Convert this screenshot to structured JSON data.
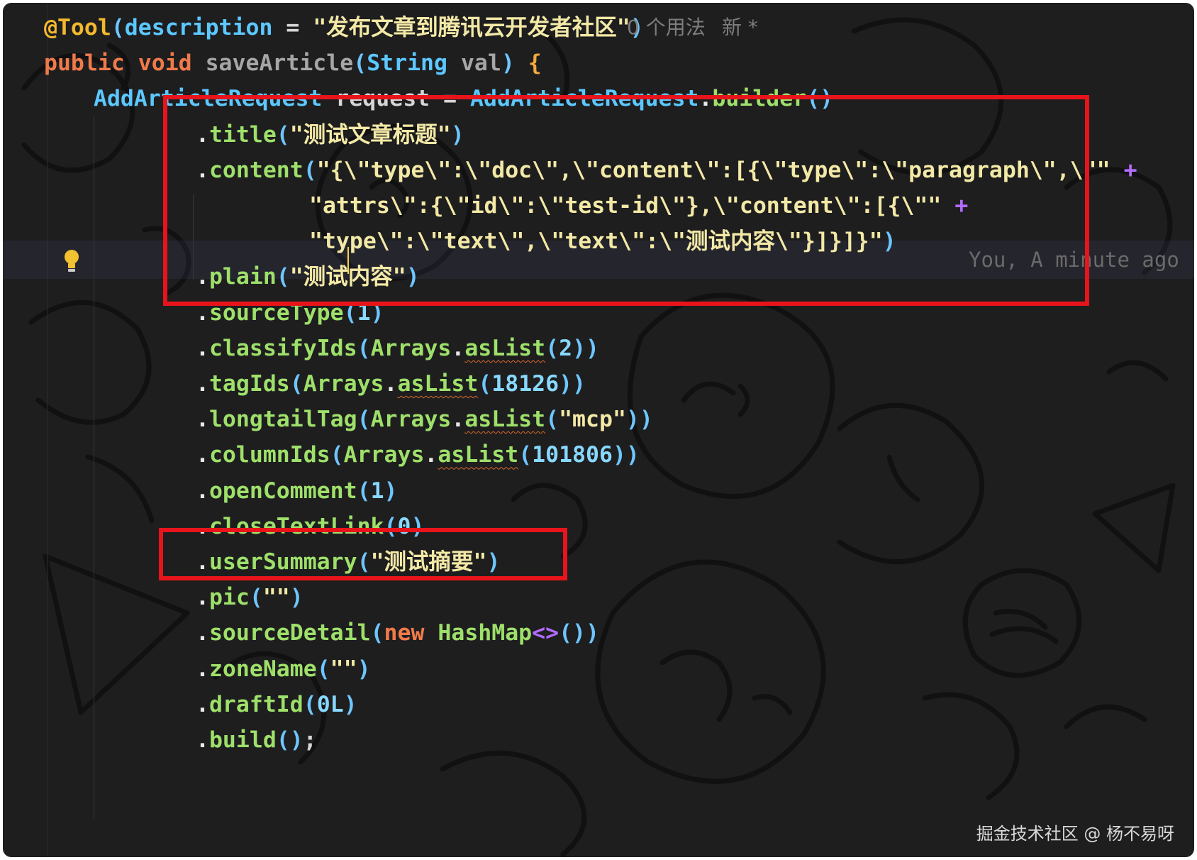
{
  "editor": {
    "annotation_hint": {
      "usages": "0 个用法",
      "status": "新 *"
    },
    "blame": "You, A minute ago",
    "lines": [
      [
        [
          "@Tool",
          "anno"
        ],
        [
          "(",
          "paren"
        ],
        [
          "description",
          "type"
        ],
        [
          " = ",
          "default"
        ],
        [
          "\"发布文章到腾讯云开发者社区\"",
          "str"
        ],
        [
          ")",
          "paren"
        ]
      ],
      [
        [
          "public",
          "kw"
        ],
        [
          " ",
          "default"
        ],
        [
          "void",
          "kw"
        ],
        [
          " ",
          "default"
        ],
        [
          "saveArticle",
          "gray"
        ],
        [
          "(",
          "paren"
        ],
        [
          "String",
          "type"
        ],
        [
          " ",
          "default"
        ],
        [
          "val",
          "gray"
        ],
        [
          ")",
          "paren"
        ],
        [
          " ",
          "default"
        ],
        [
          "{",
          "brace"
        ]
      ],
      [
        [
          "AddArticleRequest",
          "type"
        ],
        [
          " ",
          "default"
        ],
        [
          "request",
          "default"
        ],
        [
          " = ",
          "default"
        ],
        [
          "AddArticleRequest",
          "type"
        ],
        [
          ".",
          "dot"
        ],
        [
          "builder",
          "method"
        ],
        [
          "()",
          "paren"
        ]
      ],
      [
        [
          ".",
          "dot"
        ],
        [
          "title",
          "method"
        ],
        [
          "(",
          "paren"
        ],
        [
          "\"测试文章标题\"",
          "str"
        ],
        [
          ")",
          "paren"
        ]
      ],
      [
        [
          ".",
          "dot"
        ],
        [
          "content",
          "method"
        ],
        [
          "(",
          "paren"
        ],
        [
          "\"{\\\"type\\\":\\\"doc\\\",\\\"content\\\":[{\\\"type\\\":\\\"paragraph\\\",\\\"\"",
          "str"
        ],
        [
          " ",
          "default"
        ],
        [
          "+",
          "plus"
        ]
      ],
      [
        [
          "\"attrs\\\":{\\\"id\\\":\\\"test-id\\\"},\\\"content\\\":[{\\\"\"",
          "str"
        ],
        [
          " ",
          "default"
        ],
        [
          "+",
          "plus"
        ]
      ],
      [
        [
          "\"type\\\":\\\"text\\\",\\\"text\\\":\\\"测试内容\\\"}]}]}\"",
          "str"
        ],
        [
          ")",
          "paren"
        ]
      ],
      [
        [
          ".",
          "dot"
        ],
        [
          "plain",
          "method"
        ],
        [
          "(",
          "paren"
        ],
        [
          "\"测试内容\"",
          "str"
        ],
        [
          ")",
          "paren"
        ]
      ],
      [
        [
          ".",
          "dot"
        ],
        [
          "sourceType",
          "method"
        ],
        [
          "(",
          "paren"
        ],
        [
          "1",
          "num"
        ],
        [
          ")",
          "paren"
        ]
      ],
      [
        [
          ".",
          "dot"
        ],
        [
          "classifyIds",
          "method"
        ],
        [
          "(",
          "paren"
        ],
        [
          "Arrays",
          "method"
        ],
        [
          ".",
          "dot"
        ],
        [
          "asList",
          "squig"
        ],
        [
          "(",
          "paren"
        ],
        [
          "2",
          "num"
        ],
        [
          "))",
          "paren"
        ]
      ],
      [
        [
          ".",
          "dot"
        ],
        [
          "tagIds",
          "method"
        ],
        [
          "(",
          "paren"
        ],
        [
          "Arrays",
          "method"
        ],
        [
          ".",
          "dot"
        ],
        [
          "asList",
          "squig"
        ],
        [
          "(",
          "paren"
        ],
        [
          "18126",
          "num"
        ],
        [
          "))",
          "paren"
        ]
      ],
      [
        [
          ".",
          "dot"
        ],
        [
          "longtailTag",
          "method"
        ],
        [
          "(",
          "paren"
        ],
        [
          "Arrays",
          "method"
        ],
        [
          ".",
          "dot"
        ],
        [
          "asList",
          "squig"
        ],
        [
          "(",
          "paren"
        ],
        [
          "\"mcp\"",
          "str"
        ],
        [
          "))",
          "paren"
        ]
      ],
      [
        [
          ".",
          "dot"
        ],
        [
          "columnIds",
          "method"
        ],
        [
          "(",
          "paren"
        ],
        [
          "Arrays",
          "method"
        ],
        [
          ".",
          "dot"
        ],
        [
          "asList",
          "squig"
        ],
        [
          "(",
          "paren"
        ],
        [
          "101806",
          "num"
        ],
        [
          "))",
          "paren"
        ]
      ],
      [
        [
          ".",
          "dot"
        ],
        [
          "openComment",
          "method"
        ],
        [
          "(",
          "paren"
        ],
        [
          "1",
          "num"
        ],
        [
          ")",
          "paren"
        ]
      ],
      [
        [
          ".",
          "dot"
        ],
        [
          "closeTextLink",
          "method"
        ],
        [
          "(",
          "paren"
        ],
        [
          "0",
          "num"
        ],
        [
          ")",
          "paren"
        ]
      ],
      [
        [
          ".",
          "dot"
        ],
        [
          "userSummary",
          "method"
        ],
        [
          "(",
          "paren"
        ],
        [
          "\"测试摘要\"",
          "str"
        ],
        [
          ")",
          "paren"
        ]
      ],
      [
        [
          ".",
          "dot"
        ],
        [
          "pic",
          "method"
        ],
        [
          "(",
          "paren"
        ],
        [
          "\"\"",
          "str"
        ],
        [
          ")",
          "paren"
        ]
      ],
      [
        [
          ".",
          "dot"
        ],
        [
          "sourceDetail",
          "method"
        ],
        [
          "(",
          "paren"
        ],
        [
          "new",
          "kw"
        ],
        [
          " ",
          "default"
        ],
        [
          "HashMap",
          "method"
        ],
        [
          "<>",
          "plus"
        ],
        [
          "())",
          "paren"
        ]
      ],
      [
        [
          ".",
          "dot"
        ],
        [
          "zoneName",
          "method"
        ],
        [
          "(",
          "paren"
        ],
        [
          "\"\"",
          "str"
        ],
        [
          ")",
          "paren"
        ]
      ],
      [
        [
          ".",
          "dot"
        ],
        [
          "draftId",
          "method"
        ],
        [
          "(",
          "paren"
        ],
        [
          "0L",
          "num"
        ],
        [
          ")",
          "paren"
        ]
      ],
      [
        [
          ".",
          "dot"
        ],
        [
          "build",
          "method"
        ],
        [
          "()",
          "paren"
        ],
        [
          ";",
          "default"
        ]
      ]
    ]
  },
  "watermark": "掘金技术社区 @ 杨不易呀",
  "colors": {
    "background": "#1e1e1f",
    "highlight_box": "#e8141b"
  }
}
